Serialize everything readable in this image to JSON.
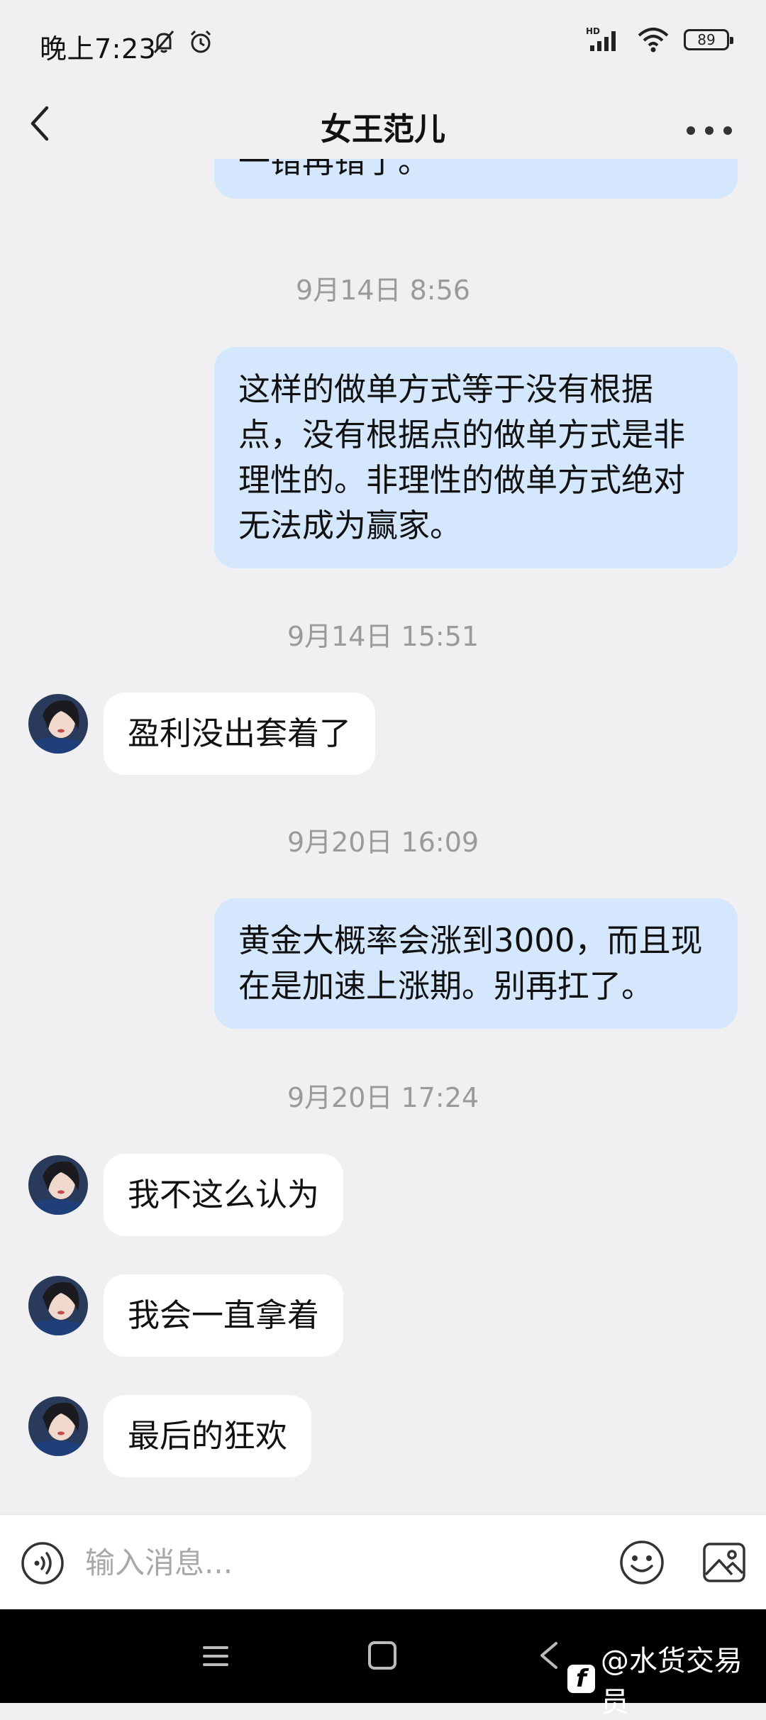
{
  "status_bar": {
    "time": "晚上7:23",
    "network_label": "HD",
    "battery": "89"
  },
  "header": {
    "title": "女王范儿"
  },
  "messages": {
    "m0": "一错再错了。",
    "ts1": "9月14日 8:56",
    "m1": "这样的做单方式等于没有根据点，没有根据点的做单方式是非理性的。非理性的做单方式绝对无法成为赢家。",
    "ts2": "9月14日 15:51",
    "m2": "盈利没出套着了",
    "ts3": "9月20日 16:09",
    "m3": "黄金大概率会涨到3000，而且现在是加速上涨期。别再扛了。",
    "ts4": "9月20日 17:24",
    "m4": "我不这么认为",
    "m5": "我会一直拿着",
    "m6": "最后的狂欢"
  },
  "input": {
    "placeholder": "输入消息..."
  },
  "watermark": {
    "logo": "f",
    "text": "@水货交易员"
  },
  "colors": {
    "background": "#f0f0f2",
    "outgoing_bubble": "#d4e7fd",
    "incoming_bubble": "#ffffff",
    "timestamp": "#9a9a9a"
  },
  "icons": {
    "back": "chevron-left-icon",
    "more": "more-dots-icon",
    "voice": "voice-icon",
    "emoji": "emoji-icon",
    "image": "image-icon"
  }
}
